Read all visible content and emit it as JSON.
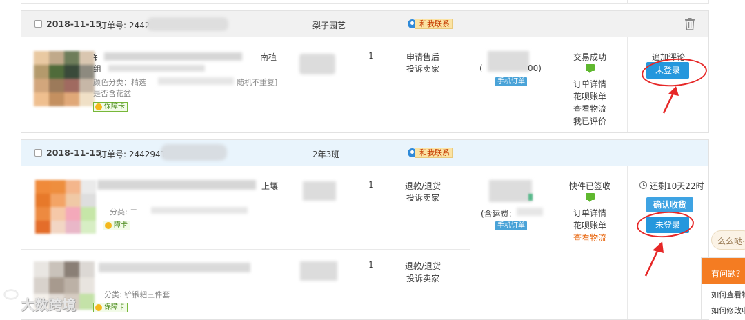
{
  "orders": [
    {
      "date": "2018-11-15",
      "order_label": "订单号: 2442",
      "shop": "梨子园艺",
      "contact": "和我联系",
      "item": {
        "title_line1": "钅",
        "title_line1_end": "南植",
        "title_line2": "组",
        "sku_prefix": "颜色分类：精选",
        "sku_mid": "随机不重复]",
        "sku_line2": "是否含花盆",
        "guarantee": "保障卡",
        "qty": "1",
        "after_sale": "申请售后",
        "complain": "投诉卖家",
        "price_suffix": "00)",
        "price_prefix": "(",
        "mobile_order": "手机订单",
        "status": "交易成功",
        "detail": "订单详情",
        "huabei": "花呗账单",
        "logistics": "查看物流",
        "reviewed": "我已评价",
        "append_review": "追加评论",
        "login_btn": "未登录"
      }
    },
    {
      "date": "2018-11-15",
      "order_label": "订单号: 2442941",
      "shop": "2年3班",
      "contact": "和我联系",
      "items": [
        {
          "title_end": "上壤",
          "sku": "分类: 二",
          "guarantee": "障卡",
          "qty": "1",
          "refund": "退款/退货",
          "complain": "投诉卖家"
        },
        {
          "sku": "分类: 铲锹耙三件套",
          "guarantee": "保障卡",
          "qty": "1",
          "refund": "退款/退货",
          "complain": "投诉卖家"
        }
      ],
      "price_note": "(含运费:",
      "mobile_order": "手机订单",
      "status": "快件已签收",
      "detail": "订单详情",
      "huabei": "花呗账单",
      "logistics": "查看物流",
      "countdown": "还剩10天22时",
      "confirm_btn": "确认收货",
      "login_btn": "未登录"
    }
  ],
  "help": {
    "title": "有问题？",
    "items": [
      "如何查看物",
      "如何修改收"
    ],
    "bubble": "么么哒~"
  },
  "watermark": "大数跨境",
  "colors": {
    "accent_blue": "#2597dd",
    "annotation_red": "#e62727",
    "help_orange": "#f47c22",
    "logistics_orange": "#e8650c"
  }
}
